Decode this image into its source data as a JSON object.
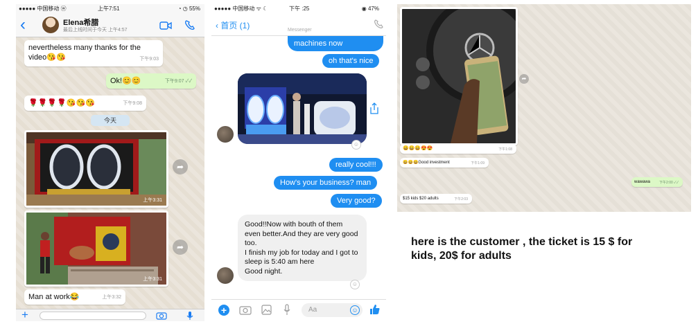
{
  "whatsapp": {
    "status": {
      "carrier": "●●●●● 中国移动 ⓦ",
      "time": "上午7:51",
      "battery": "◔ ◷ 55%"
    },
    "header": {
      "back": "‹",
      "name": "Elena希腊",
      "last_seen": "最后上线时间于今天 上午4:57",
      "video_icon": "video-icon",
      "call_icon": "phone-icon"
    },
    "messages": [
      {
        "text": "nevertheless many thanks for the video😘😘",
        "time": "下午9:03"
      },
      {
        "text": "Ok!😊😊",
        "time": "下午9:07 ✓✓"
      },
      {
        "text": "🌹🌹🌹🌹😘😘😘",
        "time": "下午9:08"
      },
      {
        "text": "今天"
      },
      {
        "time": "上午3:31"
      },
      {
        "time": "上午3:31"
      },
      {
        "text": "Man at work😂",
        "time": "上午3:32"
      }
    ],
    "footer": {
      "plus": "+",
      "camera_icon": "camera-icon",
      "mic_icon": "microphone-icon"
    }
  },
  "messenger": {
    "status": {
      "carrier": "●●●●● 中国移动 ᯤ ☾",
      "time": "下午 :25",
      "battery": "◉ 47%"
    },
    "header": {
      "back": "‹ 首页 (1)",
      "title": "Messenger"
    },
    "messages": [
      {
        "text": "machines now"
      },
      {
        "text": "oh that's nice"
      },
      {
        "text": "really cool!!!"
      },
      {
        "text": "How's your business? man"
      },
      {
        "text": "Very good?"
      },
      {
        "text": "Good!!Now with bouth of them even better.And they are very good too.\nI finish my job for today and I got to sleep is 5:40 am here\nGood night."
      }
    ],
    "footer": {
      "input_placeholder": "Aa",
      "plus_icon": "plus-icon",
      "camera_icon": "camera-icon",
      "image_icon": "image-icon",
      "mic_icon": "microphone-icon",
      "emoji_icon": "emoji-icon",
      "like_icon": "thumbs-up-icon"
    }
  },
  "whatsapp2": {
    "messages": [
      {
        "text": "😀😀😀😍😍",
        "time": "下午1:08"
      },
      {
        "text": "😀😀😀Good investment",
        "time": "下午1:09"
      },
      {
        "text": "wawawa",
        "time": "下午2:00 ✓✓"
      },
      {
        "text": "$15 kids $20 adults",
        "time": "下午2:03"
      }
    ]
  },
  "caption": "here is the customer , the ticket is 15 $ for kids, 20$ for adults"
}
